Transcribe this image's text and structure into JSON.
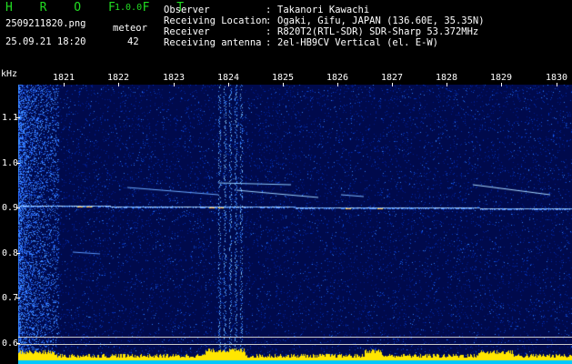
{
  "header": {
    "app_name": "H R O F F T",
    "app_version": "1.0.0",
    "filename": "2509211820.png",
    "datetime": "25.09.21 18:20",
    "meteor_label": "meteor",
    "meteor_count": "42",
    "info": [
      {
        "label": "Observer",
        "value": "Takanori Kawachi"
      },
      {
        "label": "Receiving Location",
        "value": "Ogaki, Gifu, JAPAN (136.60E, 35.35N)"
      },
      {
        "label": "Receiver",
        "value": "R820T2(RTL-SDR) SDR-Sharp 53.372MHz"
      },
      {
        "label": "Receiving antenna",
        "value": "2el-HB9CV Vertical (el. E-W)"
      }
    ]
  },
  "axes": {
    "y_unit": "kHz",
    "y_ticks": [
      "1.1",
      "1.0",
      "0.9",
      "0.8",
      "0.7",
      "0.6"
    ],
    "x_ticks": [
      "1821",
      "1822",
      "1823",
      "1824",
      "1825",
      "1826",
      "1827",
      "1828",
      "1829",
      "1830"
    ]
  },
  "colors": {
    "background": "#000000",
    "title": "#22dd22",
    "spectrum_base": "#000a50",
    "signal_line": "#c8e8ff",
    "noise_floor": "#ffe600",
    "noise_base": "#00c8ff"
  }
}
